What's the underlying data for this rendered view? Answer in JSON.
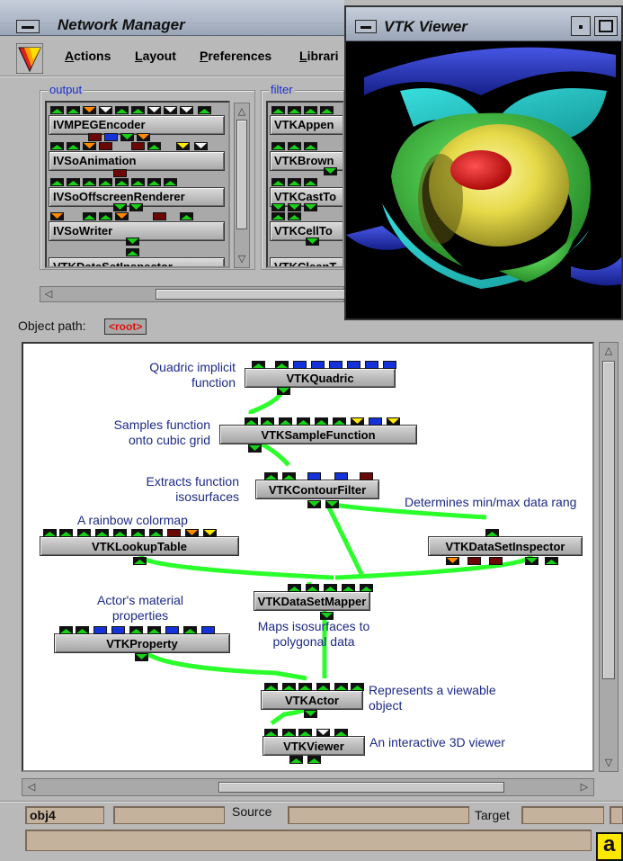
{
  "network_manager": {
    "title": "Network Manager",
    "menu": [
      {
        "label": "Actions",
        "mnemonic": "A",
        "rest": "ctions"
      },
      {
        "label": "Layout",
        "mnemonic": "L",
        "rest": "ayout"
      },
      {
        "label": "Preferences",
        "mnemonic": "P",
        "rest": "references"
      },
      {
        "label": "Librari",
        "mnemonic": "L",
        "rest": "ibrari"
      }
    ],
    "groups": {
      "output": {
        "label": "output",
        "modules": [
          "IVMPEGEncoder",
          "IVSoAnimation",
          "IVSoOffscreenRenderer",
          "IVSoWriter",
          "VTKDataSetInspector"
        ]
      },
      "filter": {
        "label": "filter",
        "modules": [
          "VTKAppen",
          "VTKBrown",
          "VTKCastTo",
          "VTKCellTo",
          "VTKCleanT"
        ]
      }
    }
  },
  "vtk_viewer": {
    "title": "VTK Viewer",
    "colors": {
      "outer": "#2f3fd8",
      "cyan": "#36e0d8",
      "green": "#39d63a",
      "yellow": "#e7dc4a",
      "red": "#e01e1e"
    }
  },
  "object_path": {
    "label": "Object path:",
    "value": "<root>"
  },
  "canvas": {
    "nodes": {
      "quadric": "VTKQuadric",
      "sample": "VTKSampleFunction",
      "contour": "VTKContourFilter",
      "lut": "VTKLookupTable",
      "inspector": "VTKDataSetInspector",
      "mapper": "VTKDataSetMapper",
      "property": "VTKProperty",
      "actor": "VTKActor",
      "viewer": "VTKViewer"
    },
    "notes": {
      "quadric_l1": "Quadric implicit",
      "quadric_l2": "function",
      "sample_l1": "Samples function",
      "sample_l2": "onto cubic grid",
      "contour_l1": "Extracts function",
      "contour_l2": "isosurfaces",
      "lut": "A rainbow colormap",
      "inspector": "Determines min/max data rang",
      "property_l1": "Actor's material",
      "property_l2": "properties",
      "mapper_l1": "Maps isosurfaces to",
      "mapper_l2": "polygonal data",
      "actor_l1": "Represents a viewable",
      "actor_l2": "object",
      "viewer": "An interactive 3D viewer"
    }
  },
  "status": {
    "object_field": "obj4",
    "source_label": "Source",
    "target_label": "Target",
    "panel_letter": "a"
  }
}
